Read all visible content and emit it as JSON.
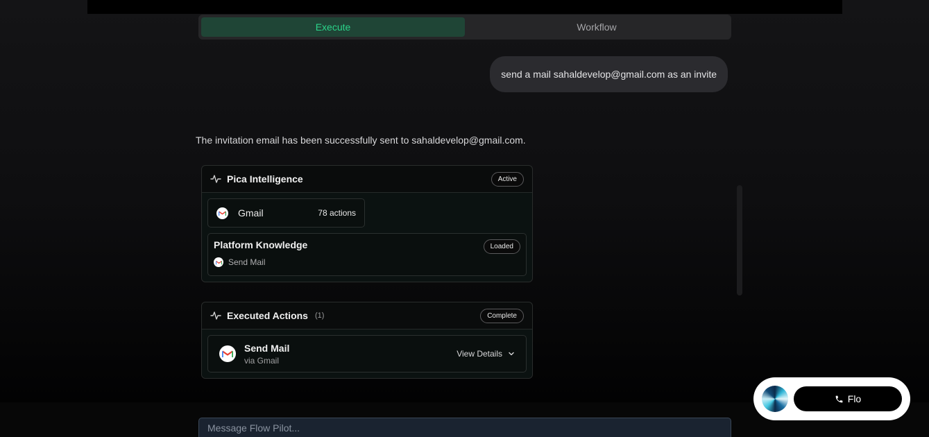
{
  "tabs": [
    {
      "label": "Execute",
      "active": true
    },
    {
      "label": "Workflow",
      "active": false
    }
  ],
  "chat": {
    "user_message": "send a mail sahaldevelop@gmail.com as an invite",
    "assistant_message": "The invitation email has been successfully sent to sahaldevelop@gmail.com."
  },
  "intelligence_card": {
    "title": "Pica Intelligence",
    "status": "Active",
    "connector": {
      "name": "Gmail",
      "actions": "78 actions",
      "icon": "gmail-icon"
    },
    "knowledge": {
      "title": "Platform Knowledge",
      "status": "Loaded",
      "item": "Send Mail"
    }
  },
  "executed_card": {
    "title": "Executed Actions",
    "count": "(1)",
    "status": "Complete",
    "action": {
      "name": "Send Mail",
      "via": "via Gmail",
      "details_label": "View Details"
    }
  },
  "composer": {
    "placeholder": "Message Flow Pilot..."
  },
  "flo": {
    "label": "Flo",
    "icon": "phone-icon"
  },
  "colors": {
    "accent_green": "#2bd48a",
    "active_tab_bg": "#1f4536"
  }
}
